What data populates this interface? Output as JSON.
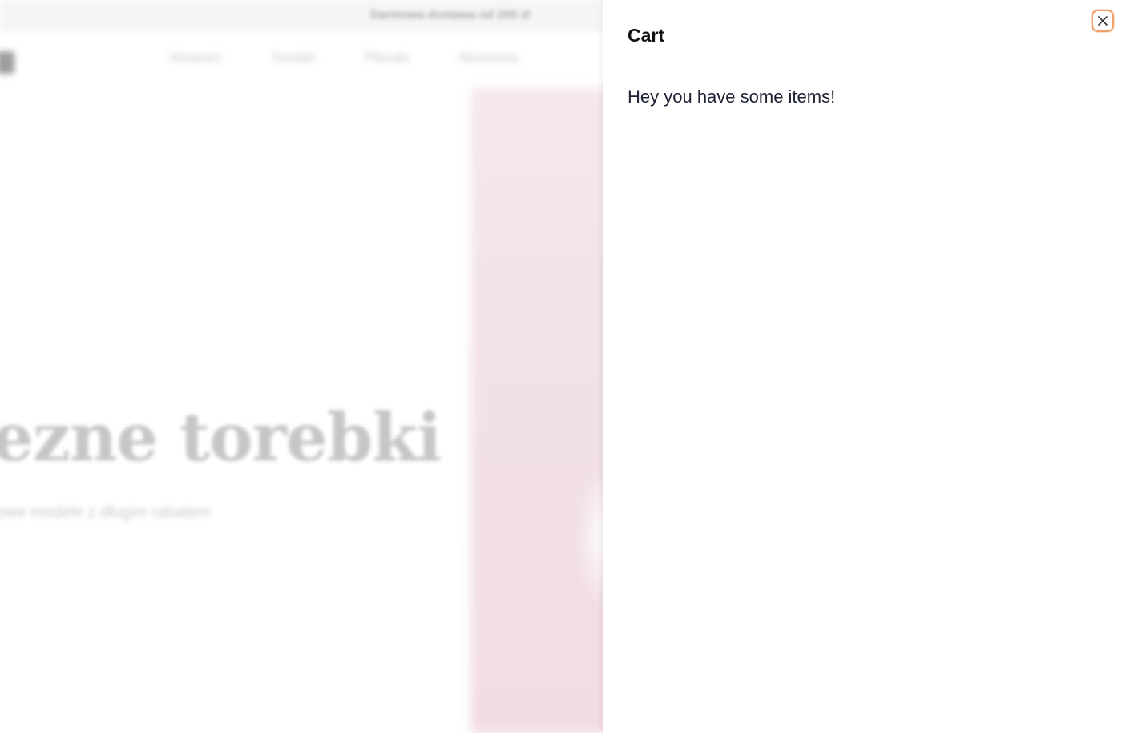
{
  "backdrop": {
    "announcement": "Darmowa dostawa od 200 zł",
    "nav_items": [
      "Nowości",
      "Torebki",
      "Plecaki",
      "Akcesoria"
    ],
    "hero_title": "ezne torebki",
    "hero_subtitle": "owe modele z długim rabatem"
  },
  "cart": {
    "title": "Cart",
    "message": "Hey you have some items!",
    "close_icon": "close-icon"
  },
  "colors": {
    "accent_focus": "#f0a06a",
    "text_primary": "#111111",
    "text_message": "#1d2033"
  }
}
